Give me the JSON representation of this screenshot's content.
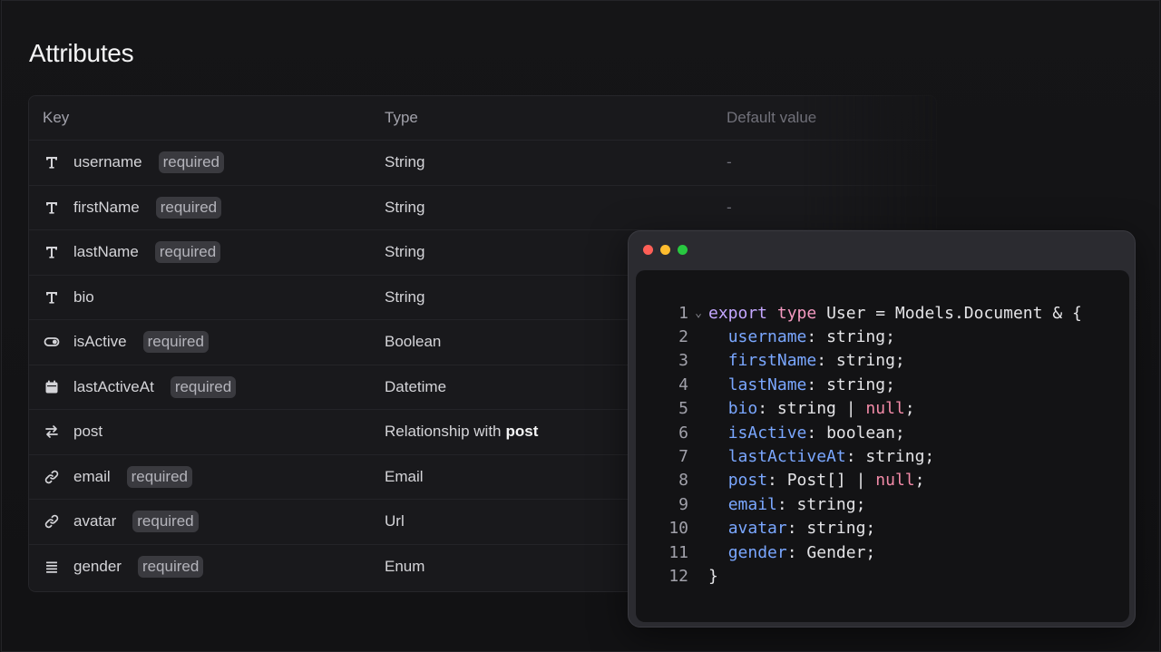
{
  "page": {
    "title": "Attributes"
  },
  "table": {
    "headers": {
      "key": "Key",
      "type": "Type",
      "default": "Default value"
    },
    "rows": [
      {
        "icon": "text-icon",
        "key": "username",
        "badge": "required",
        "type": "String",
        "default": "-"
      },
      {
        "icon": "text-icon",
        "key": "firstName",
        "badge": "required",
        "type": "String",
        "default": "-"
      },
      {
        "icon": "text-icon",
        "key": "lastName",
        "badge": "required",
        "type": "String",
        "default": ""
      },
      {
        "icon": "text-icon",
        "key": "bio",
        "badge": "",
        "type": "String",
        "default": ""
      },
      {
        "icon": "toggle-icon",
        "key": "isActive",
        "badge": "required",
        "type": "Boolean",
        "default": ""
      },
      {
        "icon": "calendar-icon",
        "key": "lastActiveAt",
        "badge": "required",
        "type": "Datetime",
        "default": ""
      },
      {
        "icon": "relationship-icon",
        "key": "post",
        "badge": "",
        "type": "Relationship with",
        "type_bold": "post",
        "default": ""
      },
      {
        "icon": "link-icon",
        "key": "email",
        "badge": "required",
        "type": "Email",
        "default": ""
      },
      {
        "icon": "link-icon",
        "key": "avatar",
        "badge": "required",
        "type": "Url",
        "default": ""
      },
      {
        "icon": "list-icon",
        "key": "gender",
        "badge": "required",
        "type": "Enum",
        "default": ""
      }
    ]
  },
  "code": {
    "lines": [
      {
        "n": "1",
        "fold": "⌄",
        "tokens": [
          [
            "kw",
            "export"
          ],
          [
            "ct",
            " "
          ],
          [
            "kw2",
            "type"
          ],
          [
            "ct",
            " User = Models.Document & {"
          ]
        ]
      },
      {
        "n": "2",
        "fold": "",
        "tokens": [
          [
            "ct",
            "  "
          ],
          [
            "prop",
            "username"
          ],
          [
            "ct",
            ": string;"
          ]
        ]
      },
      {
        "n": "3",
        "fold": "",
        "tokens": [
          [
            "ct",
            "  "
          ],
          [
            "prop",
            "firstName"
          ],
          [
            "ct",
            ": string;"
          ]
        ]
      },
      {
        "n": "4",
        "fold": "",
        "tokens": [
          [
            "ct",
            "  "
          ],
          [
            "prop",
            "lastName"
          ],
          [
            "ct",
            ": string;"
          ]
        ]
      },
      {
        "n": "5",
        "fold": "",
        "tokens": [
          [
            "ct",
            "  "
          ],
          [
            "prop",
            "bio"
          ],
          [
            "ct",
            ": string | "
          ],
          [
            "nul",
            "null"
          ],
          [
            "ct",
            ";"
          ]
        ]
      },
      {
        "n": "6",
        "fold": "",
        "tokens": [
          [
            "ct",
            "  "
          ],
          [
            "prop",
            "isActive"
          ],
          [
            "ct",
            ": boolean;"
          ]
        ]
      },
      {
        "n": "7",
        "fold": "",
        "tokens": [
          [
            "ct",
            "  "
          ],
          [
            "prop",
            "lastActiveAt"
          ],
          [
            "ct",
            ": string;"
          ]
        ]
      },
      {
        "n": "8",
        "fold": "",
        "tokens": [
          [
            "ct",
            "  "
          ],
          [
            "prop",
            "post"
          ],
          [
            "ct",
            ": Post[] | "
          ],
          [
            "nul",
            "null"
          ],
          [
            "ct",
            ";"
          ]
        ]
      },
      {
        "n": "9",
        "fold": "",
        "tokens": [
          [
            "ct",
            "  "
          ],
          [
            "prop",
            "email"
          ],
          [
            "ct",
            ": string;"
          ]
        ]
      },
      {
        "n": "10",
        "fold": "",
        "tokens": [
          [
            "ct",
            "  "
          ],
          [
            "prop",
            "avatar"
          ],
          [
            "ct",
            ": string;"
          ]
        ]
      },
      {
        "n": "11",
        "fold": "",
        "tokens": [
          [
            "ct",
            "  "
          ],
          [
            "prop",
            "gender"
          ],
          [
            "ct",
            ": Gender;"
          ]
        ]
      },
      {
        "n": "12",
        "fold": "",
        "tokens": [
          [
            "ct",
            "}"
          ]
        ]
      }
    ]
  },
  "colors": {
    "background": "#141416",
    "keyword": "#c4a7ff",
    "keyword_type": "#f49ac1",
    "property": "#7aa7ff",
    "null": "#f38ba8",
    "badge_bg": "#3a3a3f"
  }
}
